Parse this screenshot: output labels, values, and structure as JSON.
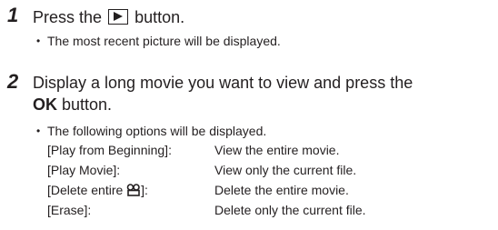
{
  "steps": [
    {
      "number": "1",
      "text_before": "Press the",
      "icon": "play-button-icon",
      "text_after": "button.",
      "bullets": [
        "The most recent picture will be displayed."
      ]
    },
    {
      "number": "2",
      "line1": "Display a long movie you want to view and press the",
      "line2_bold": "OK",
      "line2_rest": "button.",
      "bullets": [
        "The following options will be displayed."
      ],
      "options": [
        {
          "label": "[Play from Beginning]:",
          "desc": "View the entire movie."
        },
        {
          "label": "[Play Movie]:",
          "desc": "View only the current file."
        },
        {
          "label_before": "[Delete entire",
          "label_icon": "movie-icon",
          "label_after": "]:",
          "desc": "Delete the entire movie."
        },
        {
          "label": "[Erase]:",
          "desc": "Delete only the current file."
        }
      ]
    }
  ]
}
